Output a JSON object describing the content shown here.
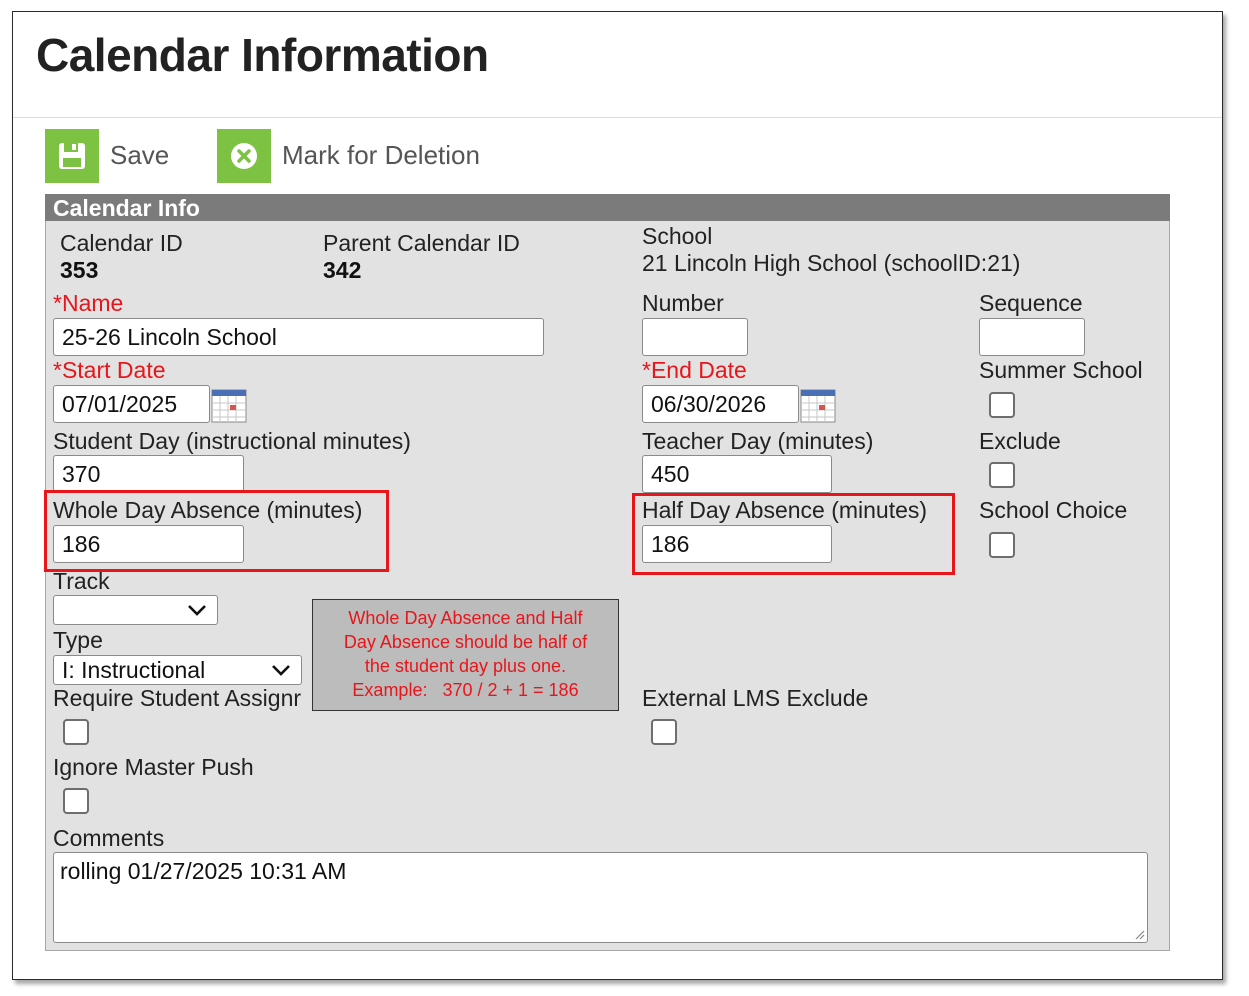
{
  "page": {
    "title": "Calendar Information"
  },
  "toolbar": {
    "save_label": "Save",
    "delete_label": "Mark for Deletion"
  },
  "panel": {
    "title": "Calendar Info"
  },
  "fields": {
    "calendar_id": {
      "label": "Calendar ID",
      "value": "353"
    },
    "parent_calendar_id": {
      "label": "Parent Calendar ID",
      "value": "342"
    },
    "school": {
      "label": "School",
      "value": "21 Lincoln High School (schoolID:21)"
    },
    "name": {
      "required_mark": "*",
      "label": "Name",
      "value": "25-26 Lincoln School"
    },
    "number": {
      "label": "Number",
      "value": ""
    },
    "sequence": {
      "label": "Sequence",
      "value": ""
    },
    "start_date": {
      "required_mark": "*",
      "label": "Start Date",
      "value": "07/01/2025"
    },
    "end_date": {
      "required_mark": "*",
      "label": "End Date",
      "value": "06/30/2026"
    },
    "summer_school": {
      "label": "Summer School",
      "checked": false
    },
    "student_day": {
      "label": "Student Day (instructional minutes)",
      "value": "370"
    },
    "teacher_day": {
      "label": "Teacher Day (minutes)",
      "value": "450"
    },
    "exclude": {
      "label": "Exclude",
      "checked": false
    },
    "whole_day_absence": {
      "label": "Whole Day Absence (minutes)",
      "value": "186"
    },
    "half_day_absence": {
      "label": "Half Day Absence (minutes)",
      "value": "186"
    },
    "school_choice": {
      "label": "School Choice",
      "checked": false
    },
    "track": {
      "label": "Track",
      "value": ""
    },
    "type": {
      "label": "Type",
      "value": "I: Instructional"
    },
    "require_student_assignment": {
      "label": "Require Student Assignr",
      "checked": false
    },
    "external_lms_exclude": {
      "label": "External LMS Exclude",
      "checked": false
    },
    "ignore_master_push": {
      "label": "Ignore Master Push",
      "checked": false
    },
    "comments": {
      "label": "Comments",
      "value": "rolling 01/27/2025 10:31 AM"
    }
  },
  "annotation": {
    "lines": [
      "Whole Day Absence and Half",
      "Day Absence should be half of",
      "the student day plus one.",
      "Example:   370 / 2 + 1 = 186"
    ]
  },
  "colors": {
    "accent_green": "#7dc242",
    "required_red": "#e8151b",
    "highlight_red": "#e8151b",
    "panel_header": "#7b7b7b",
    "panel_bg": "#e2e2e2"
  },
  "icons": {
    "save": "save-icon",
    "delete": "delete-icon",
    "calendar": "calendar-icon",
    "chevron": "chevron-down-icon"
  }
}
